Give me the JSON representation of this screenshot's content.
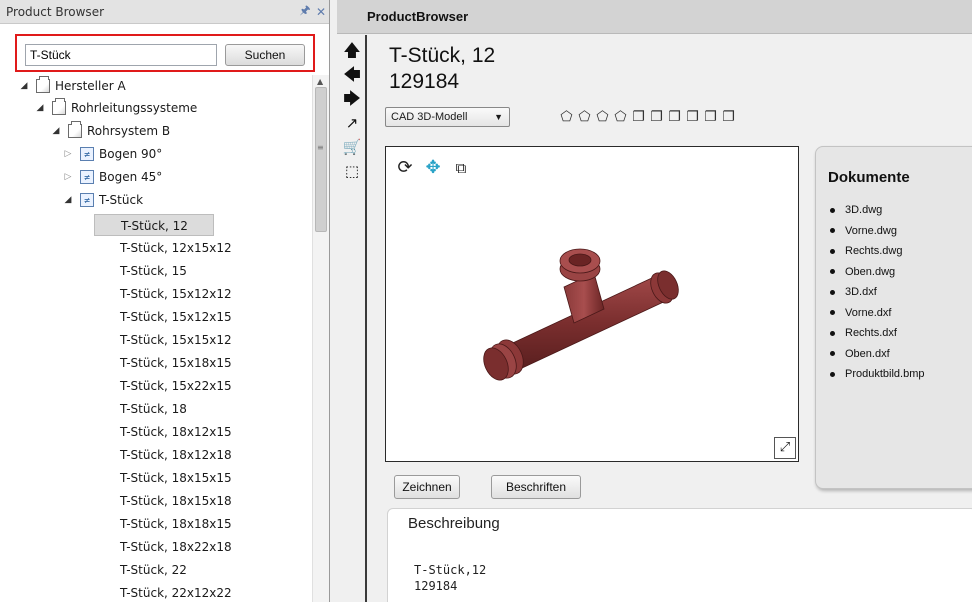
{
  "left_panel": {
    "title": "Product Browser",
    "pin_icon": "1",
    "close_icon": "✕",
    "search": {
      "value": "T-Stück",
      "button_label": "Suchen"
    },
    "tree": {
      "manufacturer": "Hersteller A",
      "category": "Rohrleitungssysteme  ",
      "system": "Rohrsystem B",
      "groups": [
        {
          "label": "Bogen 90°",
          "expanded": false
        },
        {
          "label": "Bogen 45°",
          "expanded": false
        },
        {
          "label": "T-Stück",
          "expanded": true
        }
      ],
      "items": [
        "T-Stück, 12",
        "T-Stück, 12x15x12",
        "T-Stück, 15",
        "T-Stück, 15x12x12",
        "T-Stück, 15x12x15",
        "T-Stück, 15x15x12",
        "T-Stück, 15x18x15",
        "T-Stück, 15x22x15",
        "T-Stück, 18",
        "T-Stück, 18x12x15",
        "T-Stück, 18x12x18",
        "T-Stück, 18x15x15",
        "T-Stück, 18x15x18",
        "T-Stück, 18x18x15",
        "T-Stück, 18x22x18",
        "T-Stück, 22",
        "T-Stück, 22x12x22"
      ],
      "selected_index": 0
    }
  },
  "right_panel": {
    "header": "ProductBrowser",
    "nav_icons": [
      "up-arrow-icon",
      "left-arrow-icon",
      "right-arrow-icon",
      "external-link-icon",
      "cart-icon",
      "add-selection-icon"
    ],
    "product_title": "T-Stück, 12",
    "product_number": "129184",
    "model_select": "CAD 3D-Modell",
    "viewer": {
      "tools": [
        "rotate-icon",
        "pan-icon",
        "zoom-window-icon"
      ]
    },
    "documents": {
      "title": "Dokumente",
      "items": [
        "3D.dwg",
        "Vorne.dwg",
        "Rechts.dwg",
        "Oben.dwg",
        "3D.dxf",
        "Vorne.dxf",
        "Rechts.dxf",
        "Oben.dxf",
        "Produktbild.bmp"
      ]
    },
    "buttons": {
      "draw": "Zeichnen",
      "label": "Beschriften"
    },
    "description": {
      "title": "Beschreibung",
      "line1": "T-Stück,12",
      "line2": "129184"
    }
  },
  "colors": {
    "highlight": "#e01a1a",
    "model": "#8a3a3a",
    "pan": "#2aa3c7"
  }
}
